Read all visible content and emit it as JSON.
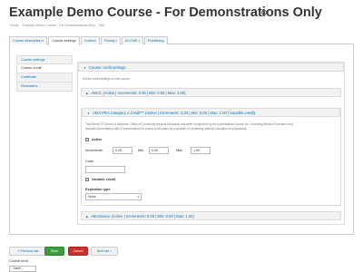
{
  "header": {
    "title": "Example Demo Course - For Demonstrations Only",
    "breadcrumb": [
      "Home",
      "Example Demo Course - For Demonstrations Only",
      "Edit"
    ]
  },
  "tabs": [
    {
      "label": "Course description",
      "dropdown": true
    },
    {
      "label": "Course settings",
      "dropdown": false,
      "active": true
    },
    {
      "label": "Custom",
      "dropdown": false
    },
    {
      "label": "Pricing",
      "dropdown": true
    },
    {
      "label": "ACCME",
      "dropdown": true
    },
    {
      "label": "Publishing",
      "dropdown": false
    }
  ],
  "vtabs": [
    {
      "label": "Course settings"
    },
    {
      "label": "Course credit",
      "active": true
    },
    {
      "label": "Certificate"
    },
    {
      "label": "Reminders"
    }
  ],
  "credit_settings": {
    "legend": "Course credit settings",
    "description": "Set the credit settings for this course.",
    "ancc_legend": "ANCC (Active | Increments: 0.00 | Min: 0.00 | Max: 1.00)",
    "ama_legend": "AMA PRA Category 1 Credit™ (Active | Increments: 0.25 | Min: 0.00 | Max: 1.00 | Variable credit)",
    "ama_description_1": "The Ethos/CE School of Medicine, Office of Continuing Medical Education has been recognized by the Accreditation Council for Continuing Medical Education and",
    "ama_description_2": "awarded Accreditation with Commendation for a term of six years as a provider of continuing medical education for physicians.",
    "active_label": "Active",
    "increments_label": "Increments",
    "increments_value": "0.25",
    "min_label": "Min",
    "min_value": "0.00",
    "max_label": "Max",
    "max_value": "1.00",
    "code_label": "Code",
    "code_value": "",
    "variable_credit_label": "Variable credit",
    "expiration_label": "Expiration type",
    "expiration_value": "None",
    "attendance_legend": "Attendance (Active | Increments: 0.00 | Min: 0.00 | Max: 1.00)"
  },
  "buttons": {
    "prev": "« Previous tab",
    "save": "Save",
    "cancel": "Cancel",
    "next": "Next tab »"
  },
  "course_term": {
    "label": "Course term",
    "value": "- None -"
  }
}
